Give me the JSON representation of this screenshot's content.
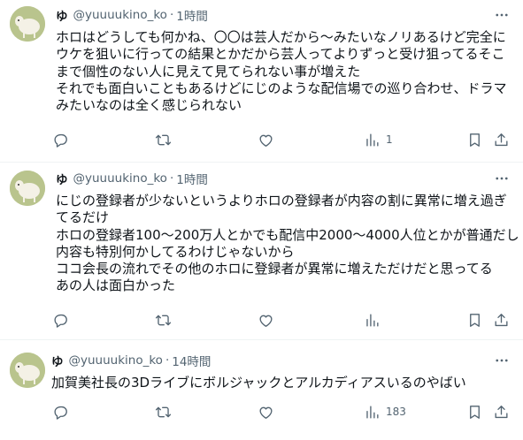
{
  "tweets": [
    {
      "name": "ゆ",
      "handle": "@yuuuukino_ko",
      "dot": "·",
      "time": "1時間",
      "lines": [
        "ホロはどうしても何かね、〇〇は芸人だから〜みたいなノリあるけど完全に",
        "ウケを狙いに行っての結果とかだから芸人ってよりずっと受け狙ってるそこ",
        "まで個性のない人に見えて見てられない事が増えた",
        "それでも面白いこともあるけどにじのような配信場での巡り合わせ、ドラマ",
        "みたいなのは全く感じられない"
      ],
      "views": "1"
    },
    {
      "name": "ゆ",
      "handle": "@yuuuukino_ko",
      "dot": "·",
      "time": "1時間",
      "lines": [
        "にじの登録者が少ないというよりホロの登録者が内容の割に異常に増え過ぎ",
        "てるだけ",
        "ホロの登録者100〜200万人とかでも配信中2000〜4000人位とかが普通だし",
        "内容も特別何かしてるわけじゃないから",
        "ココ会長の流れでその他のホロに登録者が異常に増えただけだと思ってる",
        "あの人は面白かった"
      ],
      "views": ""
    },
    {
      "name": "ゆ",
      "handle": "@yuuuukino_ko",
      "dot": "·",
      "time": "14時間",
      "lines": [
        "加賀美社長の3Dライブにボルジャックとアルカディアスいるのやばい"
      ],
      "views": "183"
    }
  ],
  "icons": {
    "reply": "reply-icon",
    "retweet": "retweet-icon",
    "like": "like-icon",
    "views": "views-icon",
    "bookmark": "bookmark-icon",
    "share": "share-icon",
    "more": "more-icon"
  },
  "colors": {
    "text": "#0f1419",
    "secondary": "#536471",
    "divider": "#eff3f4",
    "avatar_bg": "#b9c48d"
  }
}
